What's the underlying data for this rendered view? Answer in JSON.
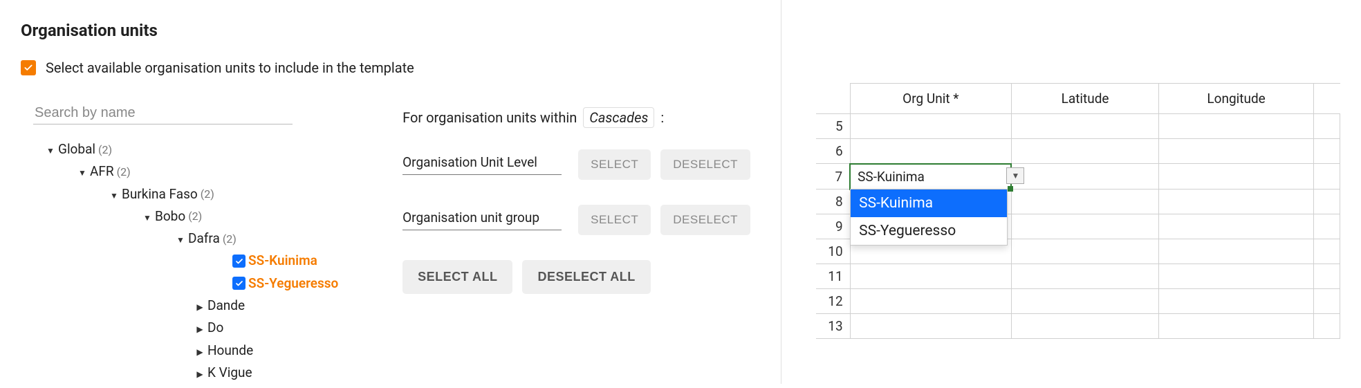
{
  "title": "Organisation units",
  "instruction": "Select available organisation units to include in the template",
  "search": {
    "placeholder": "Search by name"
  },
  "tree": {
    "n1": {
      "label": "Global",
      "count": "(2)"
    },
    "n2": {
      "label": "AFR",
      "count": "(2)"
    },
    "n3": {
      "label": "Burkina Faso",
      "count": "(2)"
    },
    "n4": {
      "label": "Bobo",
      "count": "(2)"
    },
    "n5": {
      "label": "Dafra",
      "count": "(2)"
    },
    "leaf1": "SS-Kuinima",
    "leaf2": "SS-Yegueresso",
    "c1": "Dande",
    "c2": "Do",
    "c3": "Hounde",
    "c4": "K Vigue"
  },
  "controls": {
    "within_label_prefix": "For organisation units within",
    "within_tag": "Cascades",
    "within_label_suffix": ":",
    "level_label": "Organisation Unit Level",
    "group_label": "Organisation unit group",
    "select_btn": "SELECT",
    "deselect_btn": "DESELECT",
    "select_all": "SELECT ALL",
    "deselect_all": "DESELECT ALL"
  },
  "sheet": {
    "headers": {
      "org": "Org Unit *",
      "lat": "Latitude",
      "lon": "Longitude"
    },
    "rows": [
      "5",
      "6",
      "7",
      "8",
      "9",
      "10",
      "11",
      "12",
      "13"
    ],
    "active_value": "SS-Kuinima",
    "dropdown": {
      "opt1": "SS-Kuinima",
      "opt2": "SS-Yegueresso"
    }
  }
}
